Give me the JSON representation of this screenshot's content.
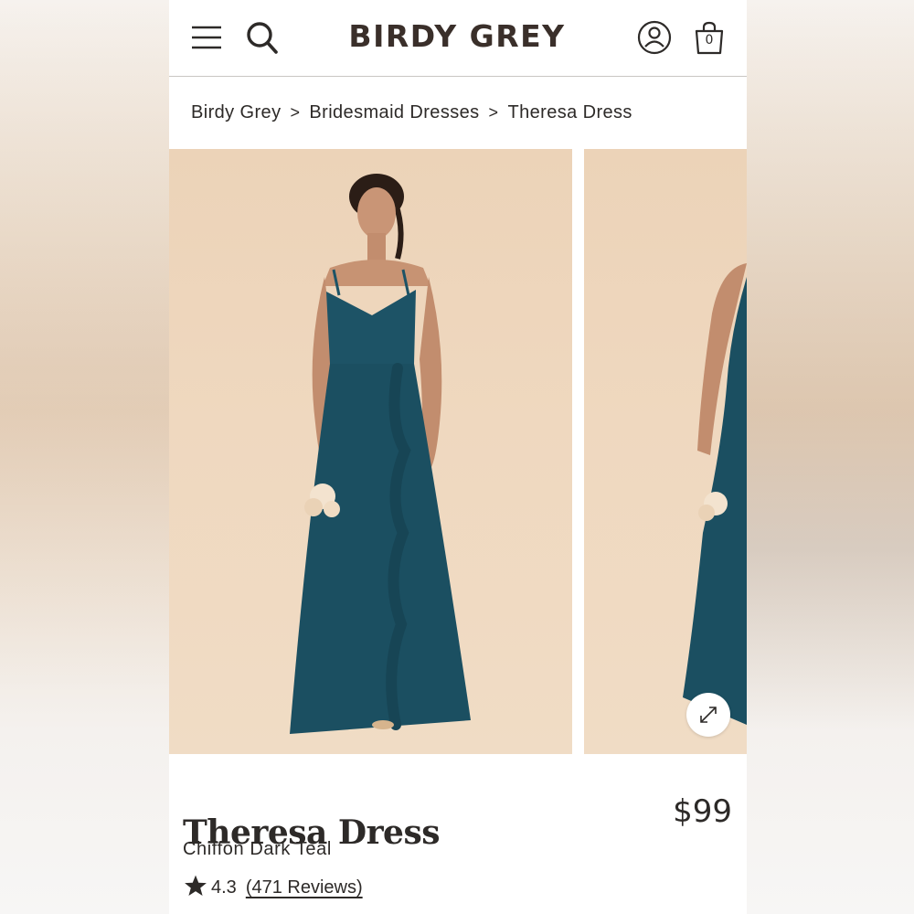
{
  "header": {
    "logo": "BIRDY GREY",
    "cart_count": "0",
    "icons": [
      "menu-icon",
      "search-icon",
      "account-icon",
      "shopping-bag-icon"
    ]
  },
  "breadcrumb": {
    "items": [
      "Birdy Grey",
      "Bridesmaid Dresses",
      "Theresa Dress"
    ],
    "separator": ">"
  },
  "gallery": {
    "images": [
      "model-front-view",
      "model-side-view"
    ],
    "expand_icon": "expand-arrows-icon",
    "dress_color": "#1d5366",
    "backdrop_color": "#edd5bb"
  },
  "product": {
    "title": "Theresa Dress",
    "price": "$99",
    "variant": "Chiffon Dark Teal",
    "rating": "4.3",
    "reviews": "(471 Reviews)"
  }
}
